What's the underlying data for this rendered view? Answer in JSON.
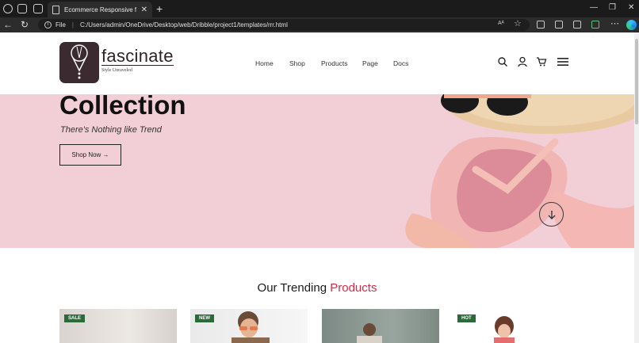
{
  "browser": {
    "tab_title": "Ecommerce Responsive full websi",
    "file_label": "File",
    "url": "C:/Users/admin/OneDrive/Desktop/web/Dribble/project1/templates/rrr.html",
    "reader_label": "Aᴬ"
  },
  "site": {
    "logo_name": "fascinate",
    "logo_tagline": "Style Unraveled",
    "nav": [
      "Home",
      "Shop",
      "Products",
      "Page",
      "Docs"
    ]
  },
  "hero": {
    "title": "Collection",
    "subtitle": "There's Nothing like Trend",
    "button": "Shop Now →"
  },
  "section": {
    "title_prefix": "Our Trending",
    "title_accent": "Products"
  },
  "products": [
    {
      "badge": "SALE"
    },
    {
      "badge": "NEW"
    },
    {
      "badge": ""
    },
    {
      "badge": "HOT"
    }
  ],
  "colors": {
    "accent": "#d72a47",
    "hero_bg": "#f2cfd7",
    "badge_bg": "#2b6b3a",
    "logo_bg": "#3b2b30"
  }
}
